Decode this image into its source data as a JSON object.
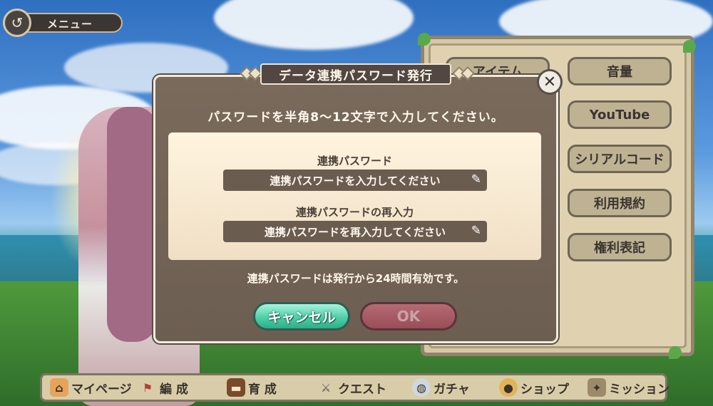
{
  "top_menu": {
    "label": "メニュー",
    "icon": "back-arrow-icon"
  },
  "settings_panel": {
    "items": [
      {
        "label": "アイテム"
      },
      {
        "label": "音量"
      },
      {
        "label": "YouTube"
      },
      {
        "label": "シリアルコード"
      },
      {
        "label": "利用規約"
      },
      {
        "label": "権利表記"
      }
    ]
  },
  "modal": {
    "title": "データ連携パスワード発行",
    "close_icon": "close-icon",
    "instruction": "パスワードを半角8～12文字で入力してください。",
    "password_label": "連携パスワード",
    "password_placeholder": "連携パスワードを入力してください",
    "confirm_label": "連携パスワードの再入力",
    "confirm_placeholder": "連携パスワードを再入力してください",
    "note": "連携パスワードは発行から24時間有効です。",
    "cancel_label": "キャンセル",
    "ok_label": "OK"
  },
  "bottom_nav": [
    {
      "label": "マイページ",
      "icon": "house-icon"
    },
    {
      "label": "編 成",
      "icon": "flag-icon"
    },
    {
      "label": "育 成",
      "icon": "book-icon"
    },
    {
      "label": "クエスト",
      "icon": "swords-icon"
    },
    {
      "label": "ガチャ",
      "icon": "egg-icon"
    },
    {
      "label": "ショップ",
      "icon": "bag-icon"
    },
    {
      "label": "ミッション",
      "icon": "mission-icon"
    }
  ],
  "colors": {
    "modal_bg": "#6d5e52",
    "cancel_green": "#4fd0a8",
    "ok_red": "#9a4d57",
    "panel_bg": "#d7c8a4"
  }
}
